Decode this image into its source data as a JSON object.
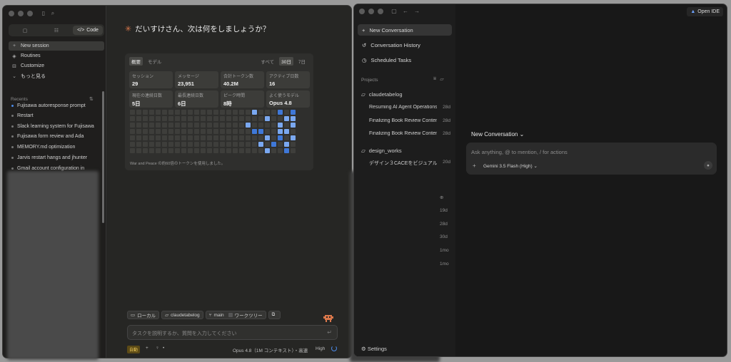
{
  "left": {
    "modes": [
      "",
      "",
      "Code"
    ],
    "nav": [
      {
        "label": "New session",
        "icon": "+"
      },
      {
        "label": "Routines",
        "icon": "◈"
      },
      {
        "label": "Customize",
        "icon": "⊟"
      },
      {
        "label": "もっと見る",
        "icon": "⌄"
      }
    ],
    "recents_title": "Recents",
    "recents": [
      "Fujisawa autoresponse prompt",
      "Restart",
      "Slack learning system for Fujisawa",
      "Fujisawa form review and Ada",
      "MEMORY.md optimization",
      "Jarvis restart hangs and jhunter",
      "Gmail account configuration in"
    ],
    "greeting": "だいすけさん、次は何をしましょうか？",
    "stats": {
      "tabs": [
        "概要",
        "モデル"
      ],
      "ranges": [
        "すべて",
        "30日",
        "7日"
      ],
      "cards": [
        {
          "label": "セッション",
          "value": "29"
        },
        {
          "label": "メッセージ",
          "value": "23,951"
        },
        {
          "label": "合計トークン数",
          "value": "40.2M"
        },
        {
          "label": "アクティブ日数",
          "value": "16"
        },
        {
          "label": "現在の連続日数",
          "value": "5日"
        },
        {
          "label": "最長連続日数",
          "value": "6日"
        },
        {
          "label": "ピーク時間",
          "value": "8時"
        },
        {
          "label": "よく使うモデル",
          "value": "Opus 4.8"
        }
      ],
      "note": "War and Peace の約60倍のトークンを使用しました。"
    },
    "chips": [
      "ローカル",
      "claudetabelog",
      "main",
      "ワークツリー",
      ""
    ],
    "prompt_placeholder": "タスクを説明するか、質問を入力してください",
    "bottom": {
      "auto": "自動",
      "model": "Opus 4.8（1M コンテキスト）・高速",
      "effort": "High"
    }
  },
  "right": {
    "nav": [
      {
        "label": "New Conversation",
        "icon": "+"
      },
      {
        "label": "Conversation History",
        "icon": "↺"
      },
      {
        "label": "Scheduled Tasks",
        "icon": "◷"
      }
    ],
    "projects_title": "Projects",
    "projects": [
      {
        "name": "claudetabelog",
        "conversations": [
          {
            "title": "Resuming AI Agent Operations",
            "age": "28d"
          },
          {
            "title": "Finalizing Book Review Content",
            "age": "28d"
          },
          {
            "title": "Finalizing Book Review Content",
            "age": "28d"
          }
        ]
      },
      {
        "name": "design_works",
        "conversations": [
          {
            "title": "デザイン３CACEをビジュアル",
            "age": "20d"
          }
        ]
      }
    ],
    "more_ages": [
      "19d",
      "28d",
      "30d",
      "1mo",
      "1mo"
    ],
    "settings": "Settings",
    "open_ide": "Open IDE",
    "conversation_title": "New Conversation",
    "chat_placeholder": "Ask anything, @ to mention, / for actions",
    "model": "Gemini 3.5 Flash (High)"
  },
  "colors": {
    "accent": "#4b8bea",
    "spark": "#d9774b",
    "auto_badge": "#e8c558"
  }
}
